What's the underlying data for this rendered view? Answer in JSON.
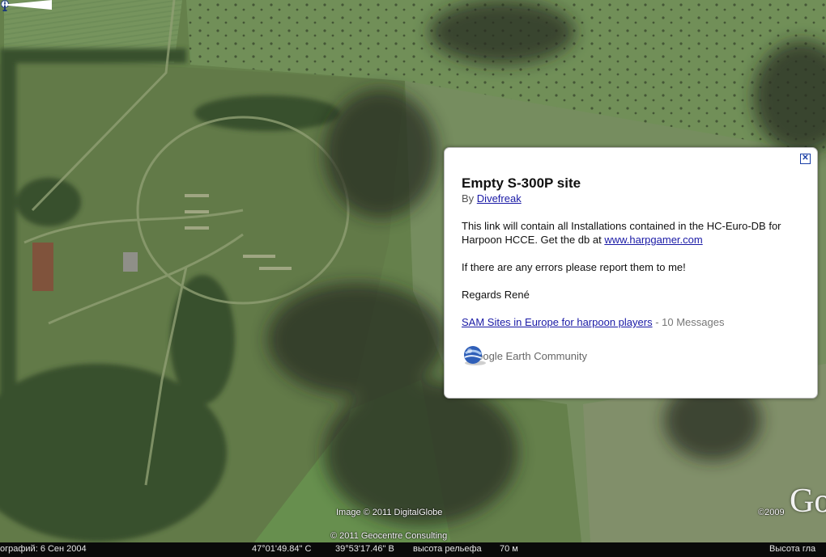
{
  "balloon": {
    "title": "Empty S-300P site",
    "by_prefix": "By",
    "author": "Divefreak",
    "description_text": "This link will contain all Installations contained in the HC-Euro-DB for Harpoon HCCE. Get the db at",
    "description_link": "www.harpgamer.com",
    "errors_line": "If there are any errors please report them to me!",
    "regards_line": "Regards René",
    "group_link": "SAM Sites in Europe for harpoon players",
    "group_suffix": " - 10 Messages",
    "community_label": "Google Earth Community",
    "close_glyph": "✕"
  },
  "map": {
    "image_credit": "Image © 2011 DigitalGlobe",
    "data_credit": "© 2011 Geocentre Consulting",
    "copyright_year": "©2009",
    "watermark": "Go"
  },
  "status": {
    "imagery_date": "ографий:  6 Сен 2004",
    "latitude": "47°01'49.84\"  С",
    "longitude": "39°53'17.46\"  В",
    "elevation_label": "высота рельефа",
    "elevation_value": "70 м",
    "eye_alt_label": "Высота гла"
  },
  "colors": {
    "link": "#1a1aa6",
    "field_green": "#5a7a3e",
    "forest_dark": "#23351c"
  }
}
